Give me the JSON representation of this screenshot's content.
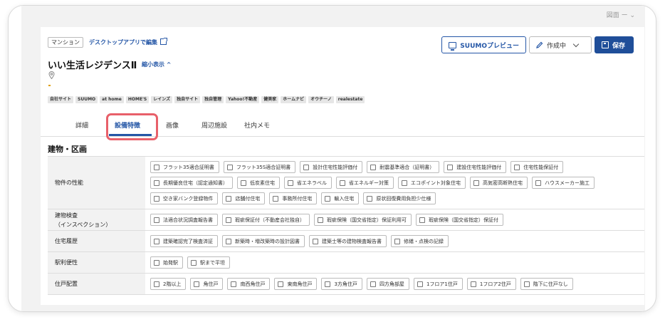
{
  "header": {
    "type_badge": "マンション",
    "desktop_link": "デスクトップアプリで編集",
    "property_title": "いい生活レジデンスⅡ",
    "collapse_label": "縮小表示 ^",
    "top_right_text": "図面 ー ⌄"
  },
  "tags": [
    "自社サイト",
    "SUUMO",
    "at home",
    "HOME'S",
    "レインズ",
    "独自サイト",
    "独自管理",
    "Yahoo!不動産",
    "健美家",
    "ホームナビ",
    "オウチーノ",
    "realestate"
  ],
  "buttons": {
    "preview": "SUUMOプレビュー",
    "status": "作成中",
    "save": "保存"
  },
  "tabs": [
    {
      "label": "詳細"
    },
    {
      "label": "設備特徴"
    },
    {
      "label": "画像"
    },
    {
      "label": "周辺施設"
    },
    {
      "label": "社内メモ"
    }
  ],
  "section_title": "建物・区画",
  "rows": [
    {
      "label": "物件の性能",
      "items": [
        "フラット35適合証明書",
        "フラット35S適合証明書",
        "設計住宅性能評価付",
        "耐震基準適合（証明書）",
        "建設住宅性能評価付",
        "住宅性能保証付",
        "長期優良住宅（認定通知書）",
        "低炭素住宅",
        "省エネラベル",
        "省エネルギー対策",
        "エコポイント対象住宅",
        "高気密高断熱住宅",
        "ハウスメーカー施工",
        "空き家バンク登録物件",
        "店舗付住宅",
        "事務所付住宅",
        "輸入住宅",
        "原状回復費用負担少仕様"
      ]
    },
    {
      "label": "建物検査\n（インスペクション）",
      "items": [
        "法適合状況調査報告書",
        "瑕疵保証付（不動産会社独自）",
        "瑕疵保険（国交省指定）保証利用可",
        "瑕疵保険（国交省指定）保証付"
      ]
    },
    {
      "label": "住宅履歴",
      "items": [
        "建築確認完了検査済証",
        "新築時・増改築時の設計図書",
        "建築士等の建物検査報告書",
        "修繕・点検の記録"
      ]
    },
    {
      "label": "駅利便性",
      "items": [
        "始発駅",
        "駅まで平坦"
      ]
    },
    {
      "label": "住戸配置",
      "items": [
        "2階以上",
        "角住戸",
        "南西角住戸",
        "東南角住戸",
        "3方角住戸",
        "四方角部屋",
        "1フロア1住戸",
        "1フロア2住戸",
        "階下に住戸なし"
      ]
    }
  ]
}
